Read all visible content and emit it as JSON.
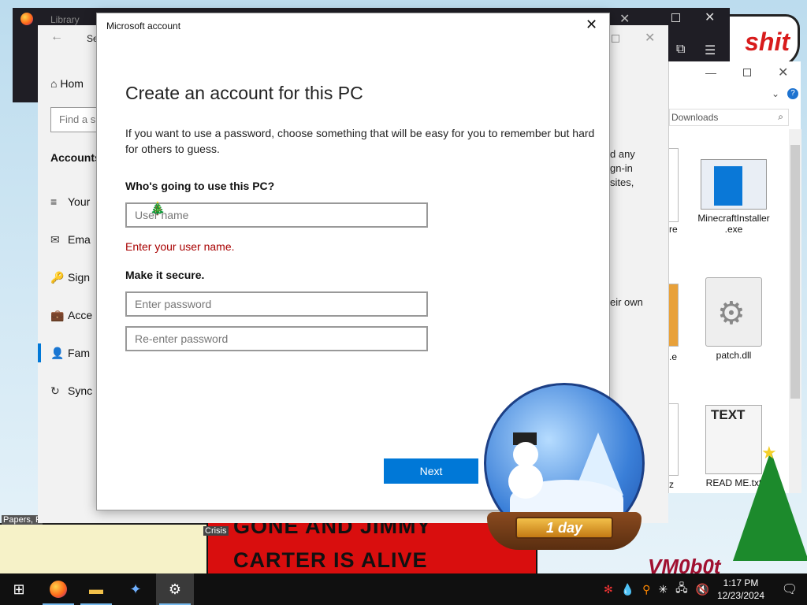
{
  "wallpaper": {
    "sign_text": "shit",
    "banner_line_1": "GONE AND JIMMY",
    "banner_line_2": "CARTER IS ALIVE",
    "signature": "VM0b0t",
    "left_label": "Papers, P",
    "crisis_label": "Crisis"
  },
  "browser": {
    "title": "Library"
  },
  "settings": {
    "title": "Se",
    "home": "Hom",
    "search_placeholder": "Find a s",
    "section": "Accounts",
    "items": [
      {
        "icon": "≡",
        "label": "Your"
      },
      {
        "icon": "✉",
        "label": "Ema"
      },
      {
        "icon": "🔑",
        "label": "Sign"
      },
      {
        "icon": "💼",
        "label": "Acce"
      },
      {
        "icon": "👤",
        "label": "Fam"
      },
      {
        "icon": "↻",
        "label": "Sync"
      }
    ],
    "frag_lines": [
      "d any",
      "gn-in",
      "sites,",
      "eir own"
    ]
  },
  "explorer": {
    "path": "Downloads",
    "files": [
      {
        "name": "MinecraftInstaller\n.exe",
        "icon": "exe-file-icon"
      },
      {
        "name": "patch.dll",
        "icon": "dll-file-icon"
      },
      {
        "name": "READ ME.txt",
        "icon": "text-file-icon",
        "badge": "TEXT"
      }
    ],
    "partial_labels": [
      "re",
      ".e",
      "z"
    ]
  },
  "dialog": {
    "window_title": "Microsoft account",
    "heading": "Create an account for this PC",
    "intro": "If you want to use a password, choose something that will be easy for you to remember but hard for others to guess.",
    "question": "Who's going to use this PC?",
    "username_placeholder": "User name",
    "username_error": "Enter your user name.",
    "secure_heading": "Make it secure.",
    "password_placeholder": "Enter password",
    "reenter_placeholder": "Re-enter password",
    "next_label": "Next"
  },
  "snowglobe": {
    "plate_text": "1 day"
  },
  "taskbar": {
    "time": "1:17 PM",
    "date": "12/23/2024"
  },
  "colors": {
    "accent": "#0078d7",
    "error": "#a80000"
  }
}
